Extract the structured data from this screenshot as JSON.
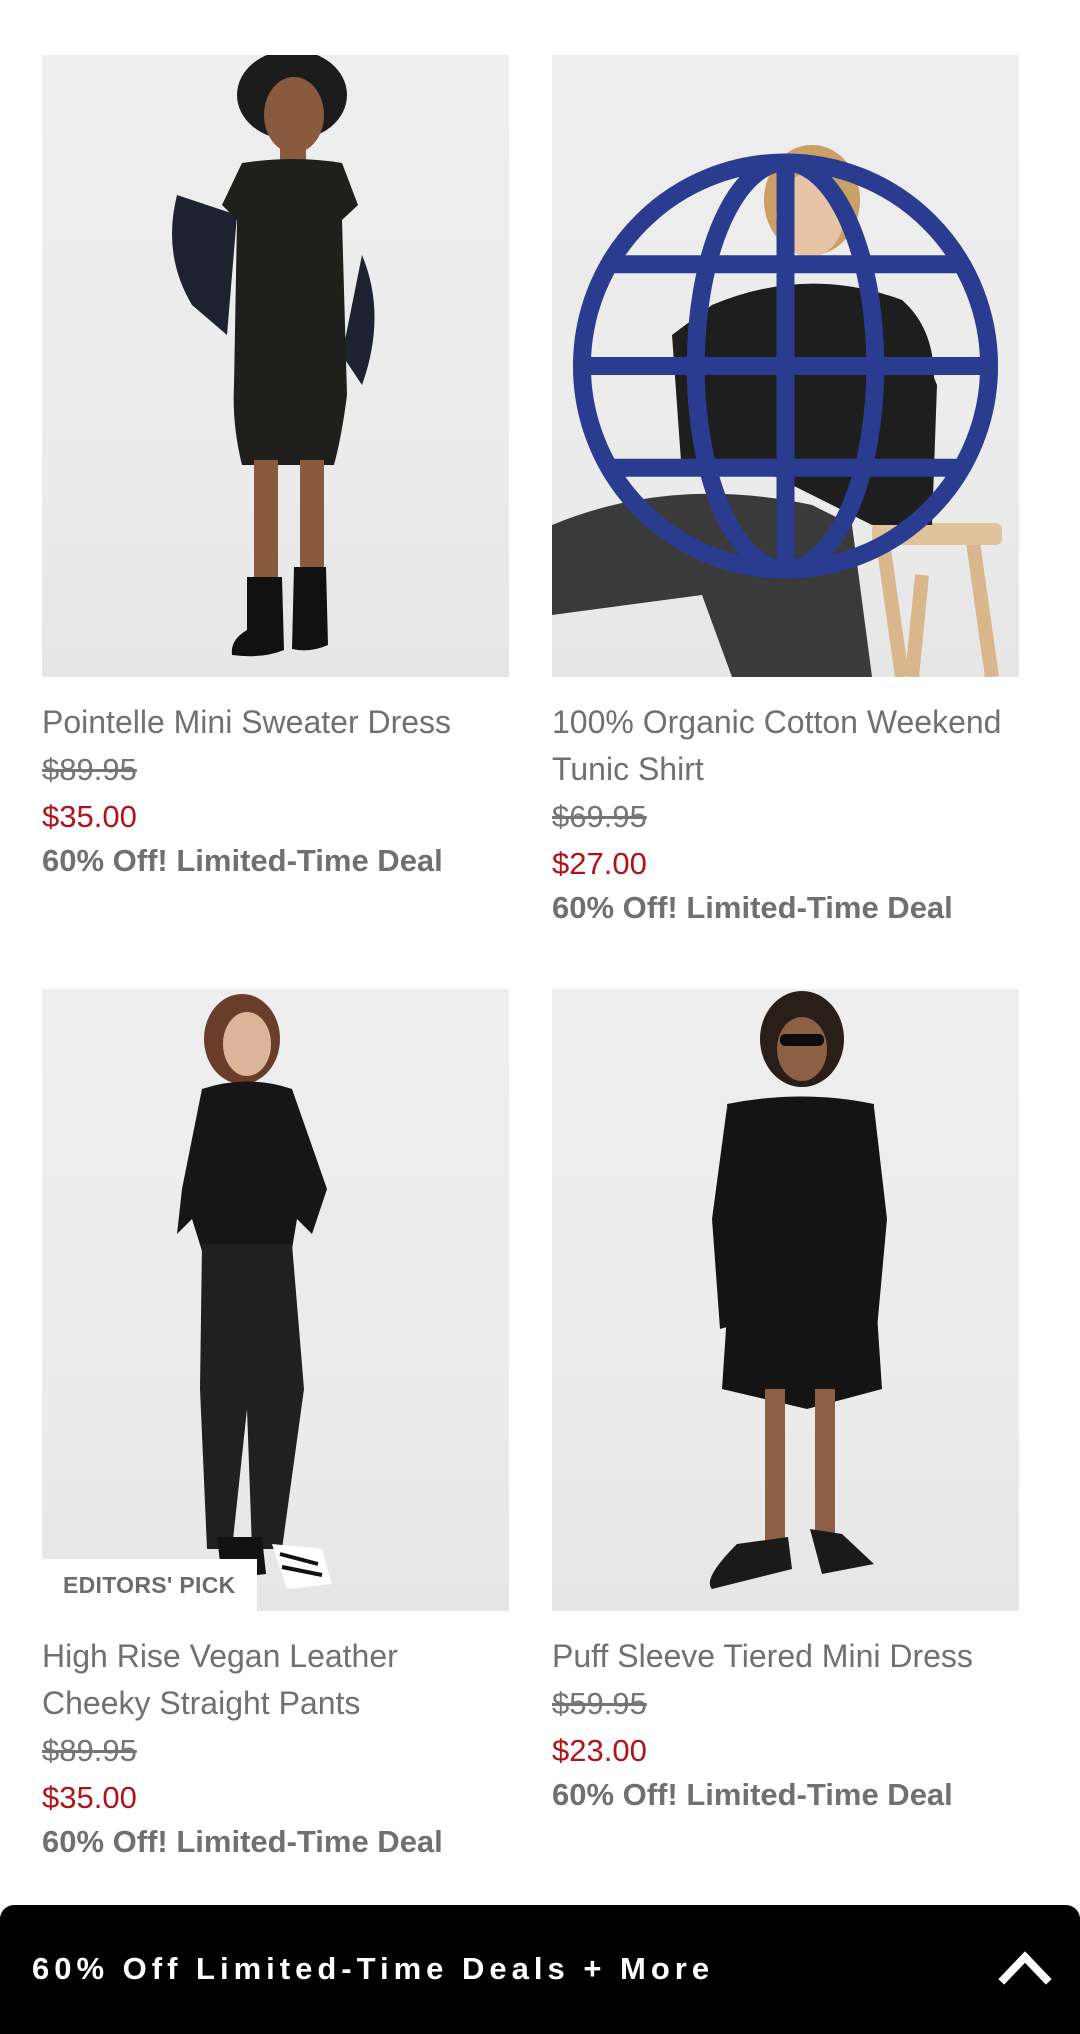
{
  "products": [
    {
      "name": "Pointelle Mini Sweater Dress",
      "original_price": "$89.95",
      "sale_price": "$35.00",
      "deal": "60% Off! Limited-Time Deal"
    },
    {
      "name": "100% Organic Cotton Weekend Tunic Shirt",
      "original_price": "$69.95",
      "sale_price": "$27.00",
      "deal": "60% Off! Limited-Time Deal"
    },
    {
      "name": "High Rise Vegan Leather Cheeky Straight Pants",
      "badge": "EDITORS' PICK",
      "original_price": "$89.95",
      "sale_price": "$35.00",
      "deal": "60% Off! Limited-Time Deal"
    },
    {
      "name": "Puff Sleeve Tiered Mini Dress",
      "original_price": "$59.95",
      "sale_price": "$23.00",
      "deal": "60% Off! Limited-Time Deal"
    }
  ],
  "promo_bar": {
    "label": "60% Off Limited-Time Deals + More",
    "icon": "chevron-up-icon"
  },
  "colors": {
    "sale_price": "#b0141a",
    "text_gray": "#707070",
    "promo_bar_bg": "#000000"
  }
}
